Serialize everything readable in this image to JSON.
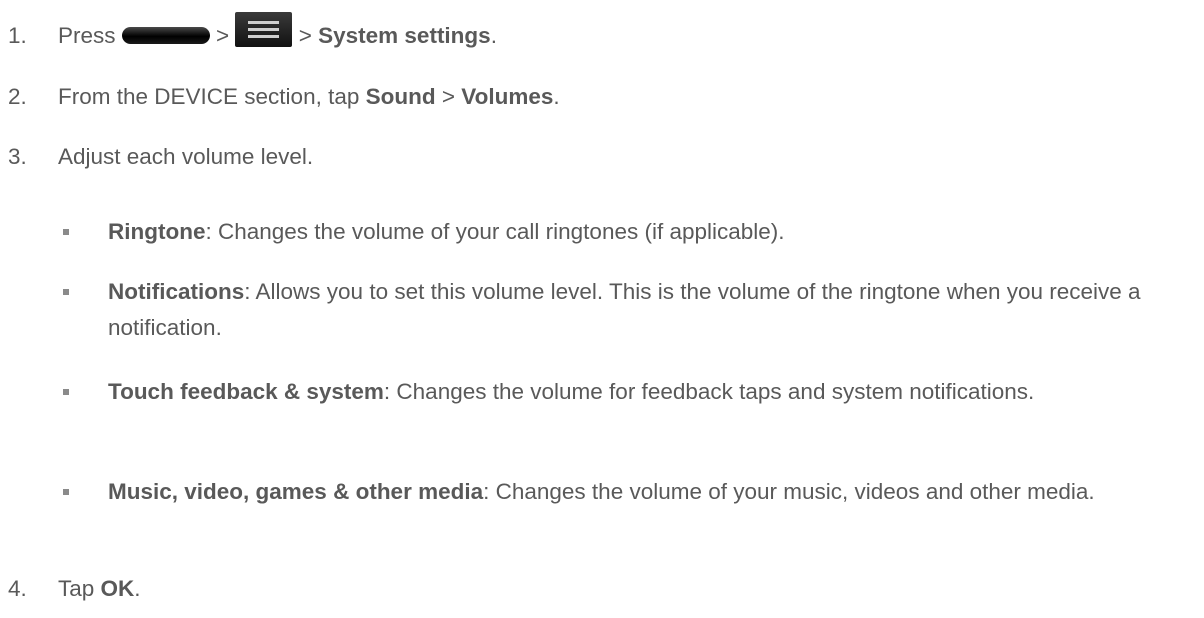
{
  "steps": [
    {
      "number": "1.",
      "text_press": "Press",
      "icon_home": "home-key-icon",
      "sep1": ">",
      "icon_menu": "menu-key-icon",
      "sep2": ">",
      "bold_system_settings": "System settings",
      "end": "."
    },
    {
      "number": "2.",
      "text_prefix": "From the DEVICE section, tap",
      "bold_sound": "Sound",
      "sep": ">",
      "bold_volumes": "Volumes",
      "end": "."
    },
    {
      "number": "3.",
      "text": "Adjust each volume level."
    },
    {
      "number": "4.",
      "text_tap": "Tap",
      "bold_ok": "OK",
      "end": "."
    }
  ],
  "sub_items": [
    {
      "title": "Ringtone",
      "desc": ": Changes the volume of your call ringtones (if applicable)."
    },
    {
      "title": "Notifications",
      "desc": ": Allows you to set this volume level. This is the volume of the ringtone when you receive a notification."
    },
    {
      "title": "Touch feedback & system",
      "desc": ": Changes the volume for feedback taps and system notifications."
    },
    {
      "title": "Music, video, games & other media",
      "desc": ": Changes the volume of your music, videos and other media."
    }
  ],
  "colors": {
    "text": "#595959",
    "bullet": "#8a8a8a"
  }
}
